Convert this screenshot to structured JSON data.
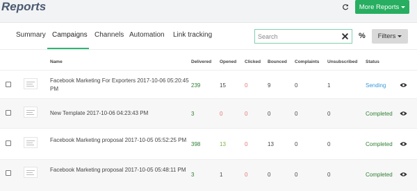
{
  "header": {
    "title": "Reports",
    "more_reports_label": "More Reports"
  },
  "tabs": [
    {
      "label": "Summary",
      "active": false
    },
    {
      "label": "Campaigns",
      "active": true
    },
    {
      "label": "Channels",
      "active": false
    },
    {
      "label": "Automation",
      "active": false
    },
    {
      "label": "Link tracking",
      "active": false
    }
  ],
  "toolbar": {
    "search_placeholder": "Search",
    "search_value": "",
    "percent_label": "%",
    "filters_label": "Filters"
  },
  "table": {
    "columns": {
      "name": "Name",
      "delivered": "Delivered",
      "opened": "Opened",
      "clicked": "Clicked",
      "bounced": "Bounced",
      "complaints": "Complaints",
      "unsubscribed": "Unsubscribed",
      "status": "Status"
    },
    "rows": [
      {
        "name": "Facebook Marketing For Exporters 2017-10-06 05:20:45 PM",
        "delivered": "239",
        "opened": "15",
        "clicked": "0",
        "bounced": "9",
        "complaints": "0",
        "unsubscribed": "1",
        "status": "Sending"
      },
      {
        "name": "New Template 2017-10-06 04:23:43 PM",
        "delivered": "3",
        "opened": "0",
        "clicked": "0",
        "bounced": "0",
        "complaints": "0",
        "unsubscribed": "0",
        "status": "Completed"
      },
      {
        "name": "Facebook Marketing proposal 2017-10-05 05:52:25 PM",
        "delivered": "398",
        "opened": "13",
        "clicked": "0",
        "bounced": "13",
        "complaints": "0",
        "unsubscribed": "0",
        "status": "Completed"
      },
      {
        "name": "Facebook Marketing proposal 2017-10-05 05:48:11 PM",
        "delivered": "3",
        "opened": "1",
        "clicked": "0",
        "bounced": "0",
        "complaints": "0",
        "unsubscribed": "0",
        "status": "Completed"
      }
    ]
  },
  "colors": {
    "accent_green": "#27ae60",
    "tab_underline": "#2bb673",
    "status_sending": "#3a9ad9",
    "status_completed": "#2e7d32",
    "zero_red": "#e57373"
  },
  "icons": {
    "refresh": "refresh-icon",
    "clear": "close-icon",
    "preview": "eye-icon",
    "thumbnail": "template-thumbnail"
  }
}
